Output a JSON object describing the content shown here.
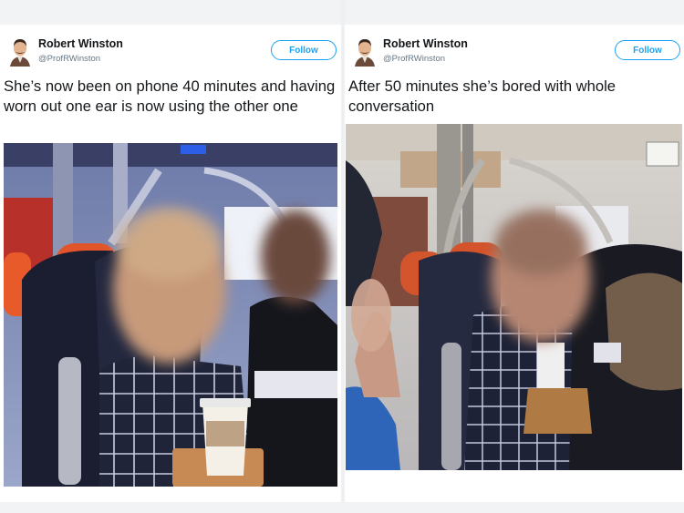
{
  "tweets": [
    {
      "author_name": "Robert Winston",
      "author_handle": "@ProfRWinston",
      "follow_label": "Follow",
      "text": "She’s now been on phone 40 minutes and having worn out one ear is now using the other one",
      "photo_icon": "train-passenger-photo"
    },
    {
      "author_name": "Robert Winston",
      "author_handle": "@ProfRWinston",
      "follow_label": "Follow",
      "text": "After 50 minutes she’s bored with whole conversation",
      "photo_icon": "train-passenger-photo"
    }
  ],
  "colors": {
    "accent": "#1da1f2",
    "text": "#14171a",
    "muted": "#657786"
  }
}
